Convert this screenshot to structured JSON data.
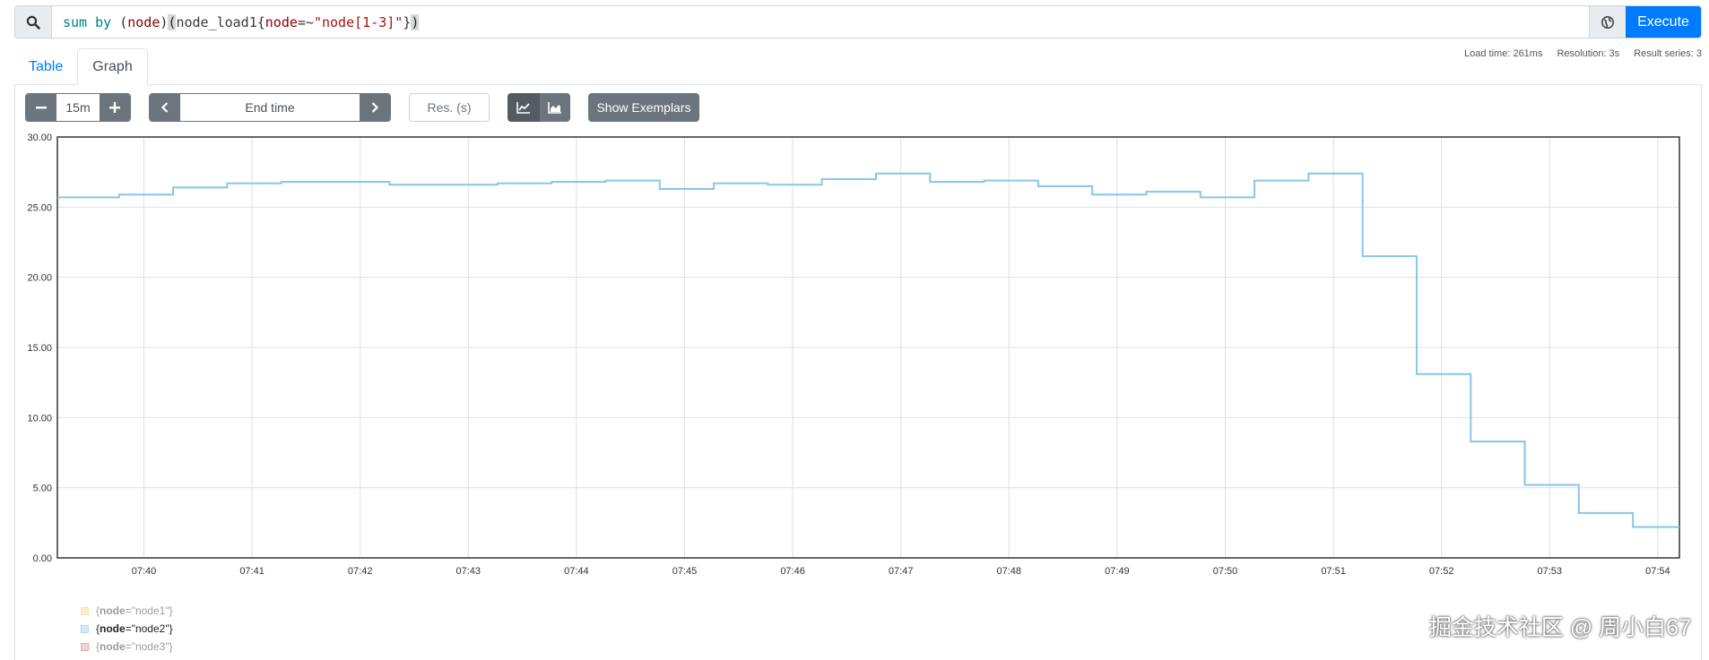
{
  "query": {
    "expression_parts": [
      {
        "text": "sum",
        "cls": "kw"
      },
      {
        "text": " ",
        "cls": "pn"
      },
      {
        "text": "by",
        "cls": "kw"
      },
      {
        "text": " (",
        "cls": "pn"
      },
      {
        "text": "node",
        "cls": "lbl"
      },
      {
        "text": ")",
        "cls": "pn"
      },
      {
        "text": "(",
        "cls": "hl"
      },
      {
        "text": "node_load1",
        "cls": "fn"
      },
      {
        "text": "{",
        "cls": "pn"
      },
      {
        "text": "node",
        "cls": "lbl"
      },
      {
        "text": "=~",
        "cls": "pn"
      },
      {
        "text": "\"node[1-3]\"",
        "cls": "str"
      },
      {
        "text": "}",
        "cls": "pn"
      },
      {
        "text": ")",
        "cls": "hl"
      }
    ],
    "execute_label": "Execute"
  },
  "tabs": [
    {
      "label": "Table",
      "active": false
    },
    {
      "label": "Graph",
      "active": true
    }
  ],
  "stats": {
    "load_time": "Load time: 261ms",
    "resolution": "Resolution: 3s",
    "result_series": "Result series: 3"
  },
  "controls": {
    "range_value": "15m",
    "end_time_placeholder": "End time",
    "res_placeholder": "Res. (s)",
    "show_exemplars_label": "Show Exemplars"
  },
  "legend": [
    {
      "label_key": "node",
      "label_value": "\"node1\"",
      "color": "#edc240",
      "dim": true
    },
    {
      "label_key": "node",
      "label_value": "\"node2\"",
      "color": "#afd8f8",
      "dim": false
    },
    {
      "label_key": "node",
      "label_value": "\"node3\"",
      "color": "#cb4b4b",
      "dim": true
    }
  ],
  "watermark": "掘金技术社区 @ 周小白67",
  "chart_data": {
    "type": "line",
    "ylim": [
      0,
      30
    ],
    "yticks": [
      "0.00",
      "5.00",
      "10.00",
      "15.00",
      "20.00",
      "25.00",
      "30.00"
    ],
    "xlim_minutes": [
      39.2,
      54.2
    ],
    "xticks": [
      "07:40",
      "07:41",
      "07:42",
      "07:43",
      "07:44",
      "07:45",
      "07:46",
      "07:47",
      "07:48",
      "07:49",
      "07:50",
      "07:51",
      "07:52",
      "07:53",
      "07:54"
    ],
    "grid": true,
    "series": [
      {
        "name": "{node=\"node2\"}",
        "color": "#87c6e8",
        "step": true,
        "x": [
          39.2,
          39.77,
          40.27,
          40.77,
          41.27,
          41.77,
          42.27,
          42.77,
          43.27,
          43.77,
          44.27,
          44.77,
          45.27,
          45.77,
          46.27,
          46.77,
          47.27,
          47.77,
          48.27,
          48.77,
          49.27,
          49.77,
          50.27,
          50.77,
          51.27,
          51.77,
          52.27,
          52.77,
          53.27,
          53.77,
          54.2
        ],
        "values": [
          25.7,
          25.9,
          26.4,
          26.7,
          26.8,
          26.8,
          26.6,
          26.6,
          26.7,
          26.8,
          26.9,
          26.3,
          26.7,
          26.6,
          27.0,
          27.4,
          26.8,
          26.9,
          26.5,
          25.9,
          26.1,
          25.7,
          26.9,
          27.4,
          21.5,
          13.1,
          8.3,
          5.2,
          3.2,
          2.2,
          2.2
        ]
      }
    ]
  }
}
